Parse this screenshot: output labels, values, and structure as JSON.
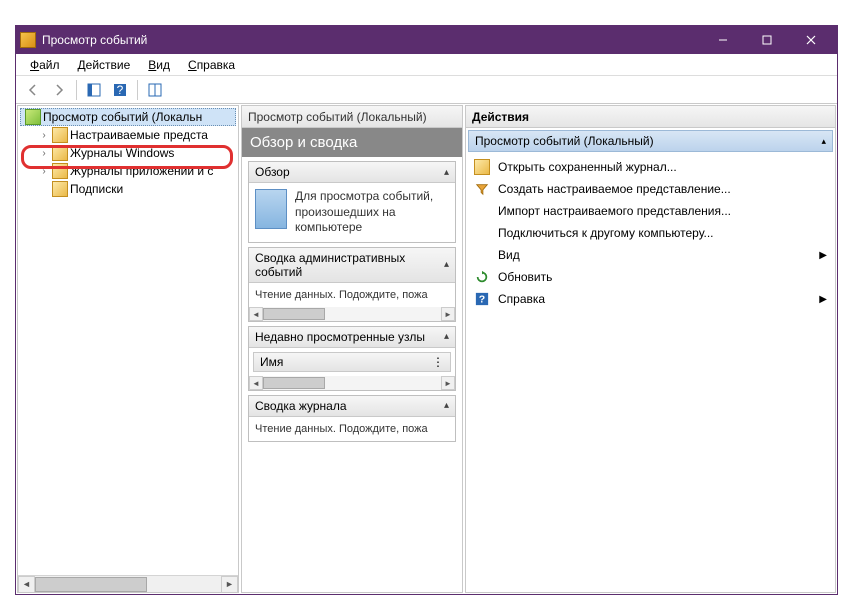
{
  "window": {
    "title": "Просмотр событий"
  },
  "menubar": {
    "file": "Файл",
    "action": "Действие",
    "view": "Вид",
    "help": "Справка"
  },
  "tree": {
    "root": "Просмотр событий (Локальн",
    "items": [
      "Настраиваемые предста",
      "Журналы Windows",
      "Журналы приложений и с",
      "Подписки"
    ]
  },
  "mid": {
    "header": "Просмотр событий (Локальный)",
    "title": "Обзор и сводка",
    "sections": {
      "overview": {
        "label": "Обзор",
        "text": "Для просмотра событий, произошедших на компьютере"
      },
      "admin": {
        "label": "Сводка административных событий",
        "text": "Чтение данных. Подождите, пожа"
      },
      "recent": {
        "label": "Недавно просмотренные узлы",
        "col": "Имя"
      },
      "summary": {
        "label": "Сводка журнала",
        "text": "Чтение данных. Подождите, пожа"
      }
    }
  },
  "right": {
    "header": "Действия",
    "sub": "Просмотр событий (Локальный)",
    "actions": {
      "open": "Открыть сохраненный журнал...",
      "create": "Создать настраиваемое представление...",
      "import": "Импорт настраиваемого представления...",
      "connect": "Подключиться к другому компьютеру...",
      "view": "Вид",
      "refresh": "Обновить",
      "help": "Справка"
    }
  }
}
